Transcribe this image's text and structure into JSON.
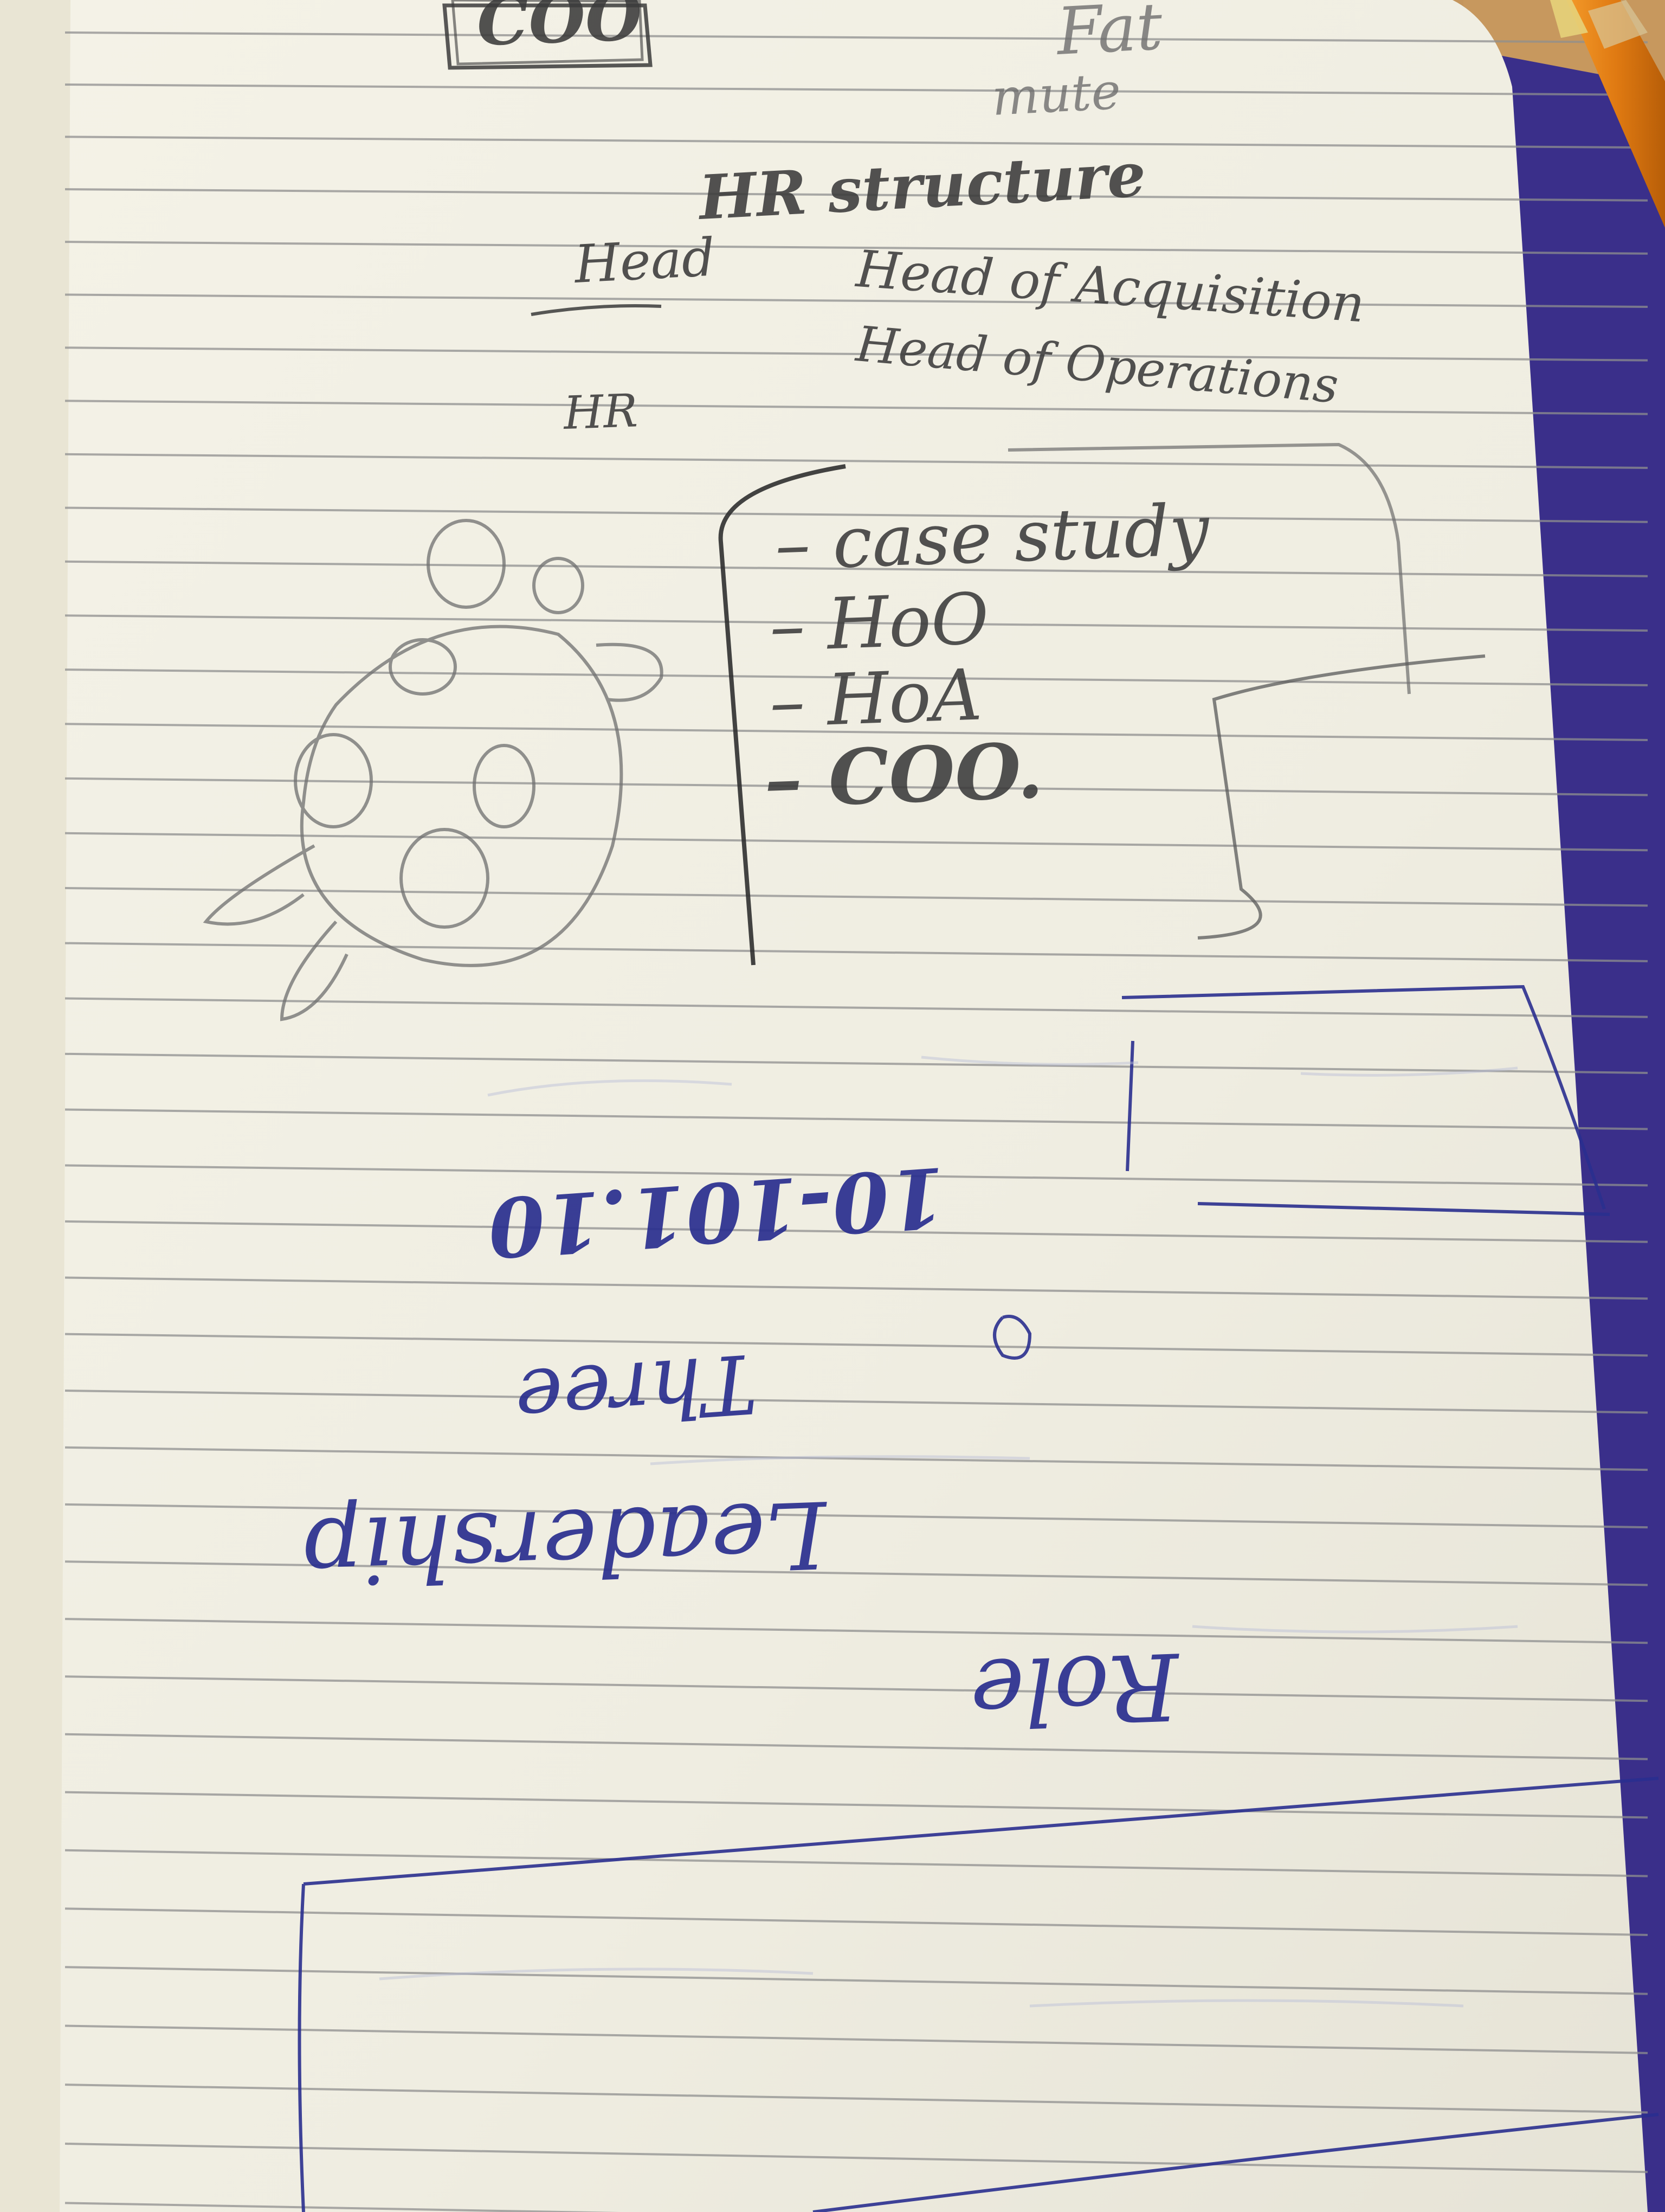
{
  "colors": {
    "paper": "#f3f1e6",
    "ruling": "#8f8f8f",
    "pencil": "#3b3b3b",
    "ink": "#2a2f8f",
    "cover": "#3a2f8a",
    "desk": "#b8874f",
    "pencil_body": "#e07a12"
  },
  "notes": {
    "top_box": "COO",
    "top_1": "Fat",
    "top_2": "mute",
    "heading": "HR structure",
    "row1_left": "Head",
    "row1_right": "Head of Acquisition",
    "row2_right": "Head of Operations",
    "row3_left": "HR",
    "list": [
      "case study",
      "HoO",
      "HoA",
      "COO."
    ]
  },
  "upside_down_notes": {
    "line1": "10-101.10",
    "line2": "Three",
    "line3": "Leadership",
    "line4": "Role"
  }
}
